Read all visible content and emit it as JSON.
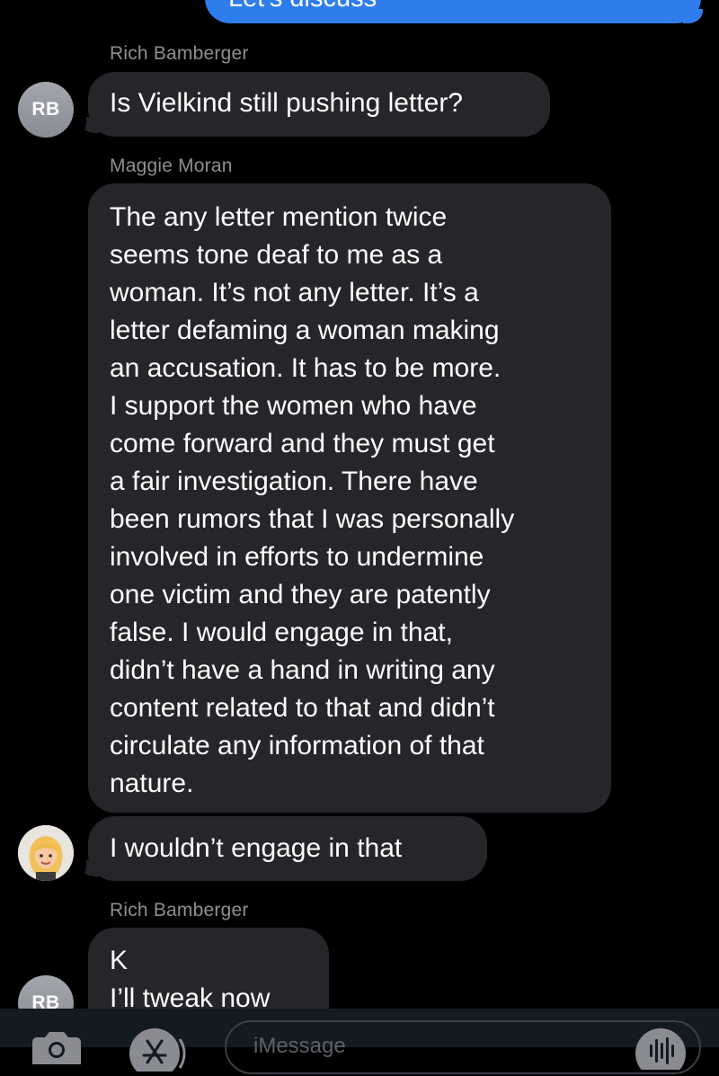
{
  "outgoing": {
    "text": "Let's discuss"
  },
  "messages": [
    {
      "sender": "Rich Bamberger",
      "avatar_initials": "RB",
      "text_lines": [
        "Is Vielkind still pushing letter?"
      ]
    },
    {
      "sender": "Maggie Moran",
      "text_lines": [
        "The any letter mention twice",
        "seems tone deaf to me as a",
        "woman. It’s not any letter. It’s a",
        "letter defaming a woman making",
        "an accusation. It has to be more.",
        "I support the women who have",
        "come forward and they must get",
        "a fair investigation. There have",
        "been rumors that I was personally",
        "involved in efforts to undermine",
        "one victim and they are patently",
        "false. I would engage in that,",
        "didn’t have a hand in writing any",
        "content related to that and didn’t",
        "circulate any information of that",
        "nature."
      ]
    },
    {
      "sender": "Maggie Moran",
      "avatar": "memoji-avatar",
      "text_lines": [
        "I wouldn’t engage in that"
      ]
    },
    {
      "sender": "Rich Bamberger",
      "avatar_initials": "RB",
      "text_lines": [
        "K",
        "I’ll tweak now"
      ]
    }
  ],
  "input_bar": {
    "camera_icon": "camera-icon",
    "apps_icon": "app-store-icon",
    "placeholder": "iMessage",
    "audio_icon": "waveform-icon"
  },
  "colors": {
    "background": "#000000",
    "incoming_bubble": "#26262a",
    "outgoing_bubble": "#2f7dec",
    "sender_name": "#8e8e93",
    "avatar_gray": "#9a9ca3"
  }
}
